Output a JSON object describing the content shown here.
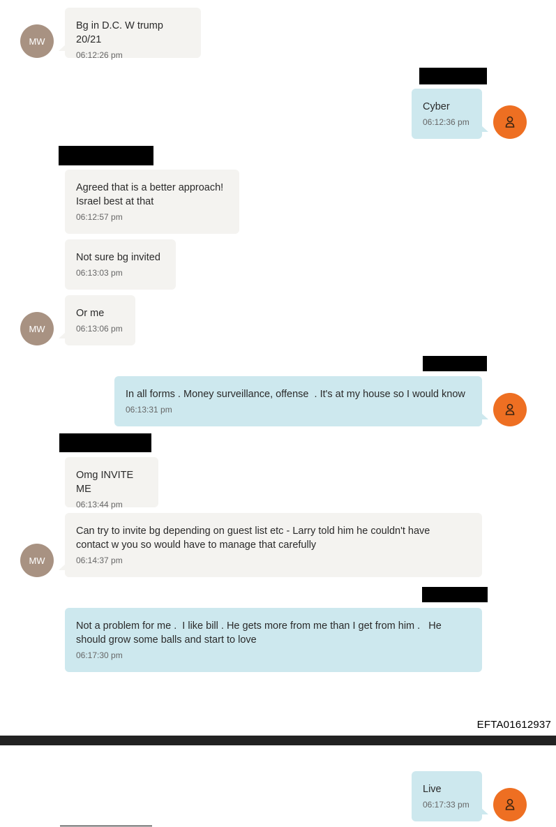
{
  "contacts": {
    "other_initials": "MW"
  },
  "messages": [
    {
      "text": "Bg in D.C. W trump 20/21",
      "time": "06:12:26 pm"
    },
    {
      "text": "Cyber",
      "time": "06:12:36 pm"
    },
    {
      "text": "Agreed that is a better approach!\nIsrael best at that",
      "time": "06:12:57 pm"
    },
    {
      "text": "Not sure bg invited",
      "time": "06:13:03 pm"
    },
    {
      "text": "Or me",
      "time": "06:13:06 pm"
    },
    {
      "text": "In all forms . Money surveillance, offense  . It's at my house so I would know",
      "time": "06:13:31 pm"
    },
    {
      "text": "Omg INVITE ME",
      "time": "06:13:44 pm"
    },
    {
      "text": "Can try to invite bg depending on guest list etc - Larry told him he couldn't have\ncontact w you so would have to manage that carefully",
      "time": "06:14:37 pm"
    },
    {
      "text": "Not a problem for me .  I like bill . He gets more from me than I get from him .   He\nshould grow some balls and start to love",
      "time": "06:17:30 pm"
    },
    {
      "text": "Live",
      "time": "06:17:33 pm"
    }
  ],
  "footer": {
    "doc_id": "EFTA01612937"
  },
  "colors": {
    "incoming_bubble": "#f4f3f0",
    "outgoing_bubble": "#cde8ee",
    "mw_avatar": "#a89282",
    "self_avatar": "#ee6f22"
  }
}
